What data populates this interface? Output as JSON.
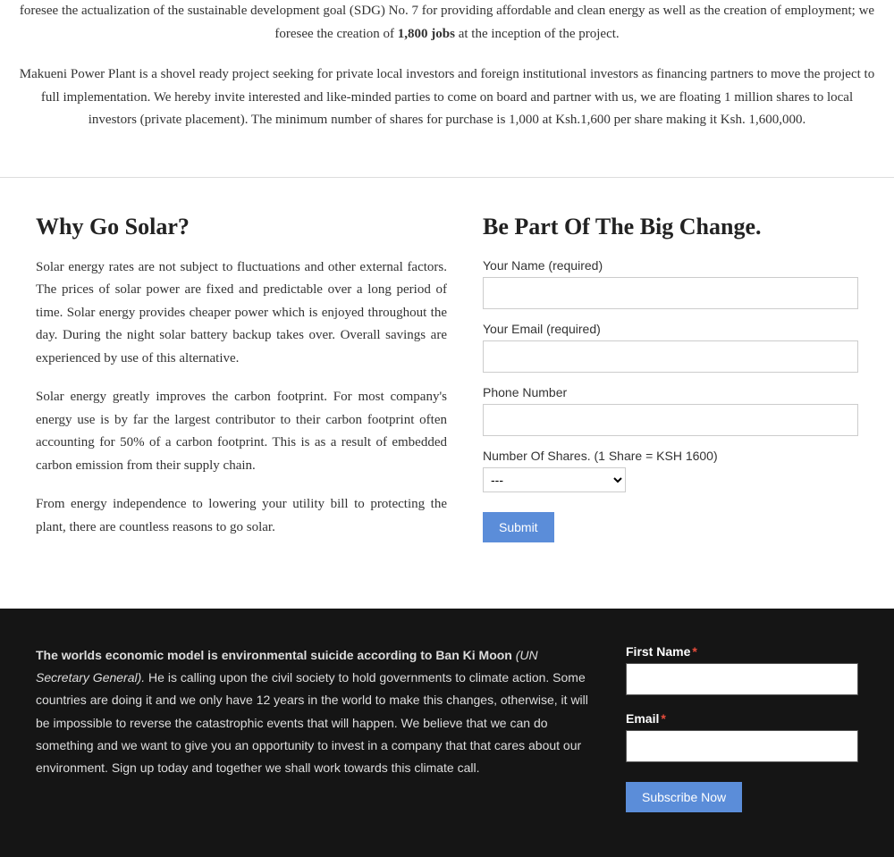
{
  "top": {
    "paragraph1": "foresee the actualization of the sustainable development goal (SDG) No. 7 for providing affordable and clean energy as well as the creation of employment; we foresee the creation of ",
    "bold_text": "1,800 jobs",
    "paragraph1_end": " at the inception of the project.",
    "paragraph2": "Makueni Power Plant is a shovel ready project seeking for private local investors and foreign institutional investors as financing partners to move the project to full implementation. We hereby invite interested and like-minded parties to come on board and partner with us, we are floating 1 million shares to local investors (private placement). The minimum number of shares for purchase is 1,000 at Ksh.1,600 per share making it Ksh. 1,600,000."
  },
  "middle": {
    "left_title": "Why Go Solar?",
    "left_paragraphs": [
      "Solar energy rates are not subject to fluctuations and other external factors. The prices of solar power are fixed and predictable over a long period of time. Solar energy provides cheaper power which is enjoyed throughout the day. During the night solar battery backup takes over. Overall savings are experienced by use of this alternative.",
      "Solar energy greatly improves the carbon footprint. For most company's energy use is by far the largest contributor to their carbon footprint often accounting for 50% of a carbon footprint. This is as a result of embedded carbon emission from their supply chain.",
      "From energy independence to lowering your utility bill to protecting the plant, there are countless reasons to go solar."
    ],
    "right_title": "Be Part Of The Big Change.",
    "form": {
      "name_label": "Your Name (required)",
      "email_label": "Your Email (required)",
      "phone_label": "Phone Number",
      "shares_label": "Number Of Shares. (1 Share = KSH 1600)",
      "shares_placeholder": "---",
      "submit_label": "Submit"
    }
  },
  "bottom": {
    "quote_text": "The worlds economic model is environmental suicide according to Ban Ki Moon ",
    "quote_author": "(UN Secretary General).",
    "quote_body": " He is calling upon the civil society to hold governments to climate action. Some countries are doing it and we only have 12 years in the world to make this changes, otherwise, it will be impossible to reverse the catastrophic events that will happen. We believe that we can do something and we want to give you an opportunity to invest in a company that that cares about our environment.  Sign up today and together we shall work towards this climate call.",
    "first_name_label": "First Name",
    "email_label": "Email",
    "required_star": "*",
    "subscribe_label": "Subscribe Now"
  }
}
